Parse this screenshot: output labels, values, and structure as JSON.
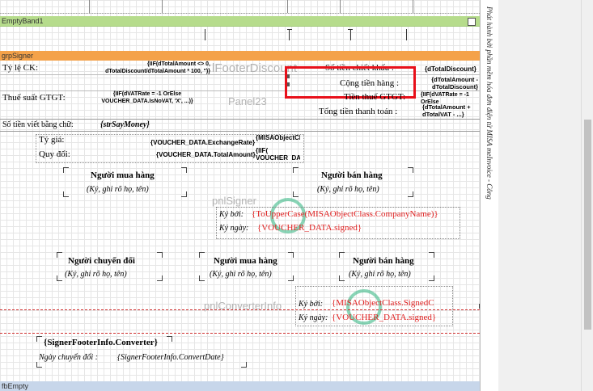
{
  "bands": {
    "empty_band": "EmptyBand1",
    "signer_band": "grpSigner",
    "empty_footer": "fbEmpty"
  },
  "footer_rows": {
    "discount_rate_label": "Tỷ lệ CK:",
    "discount_rate_expr": "{IIF(dTotalAmount <> 0, dTotalDiscount/dTotalAmount * 100, '')}",
    "discount_amount_label": "Số tiền chiết khấu :",
    "discount_amount_expr": "{dTotalDiscount}",
    "total_label": "Cộng tiền hàng :",
    "total_expr": "{dTotalAmount - dTotalDiscount}",
    "vat_rate_label": "Thuế suất GTGT:",
    "vat_rate_expr": "{IIF(dVATRate = -1 OrElse VOUCHER_DATA.IsNoVAT, 'X', ...)}",
    "vat_amount_label": "Tiền thuế GTGT:",
    "vat_amount_expr": "{IIF(dVATRate = -1 OrElse VOUCHER_DATA ...}",
    "grand_total_label": "Tổng tiền thanh toán :",
    "grand_total_expr": "{dTotalAmount + dTotalVAT - ...}",
    "in_words_label": "Số tiền viết bằng chữ:",
    "in_words_expr": "{strSayMoney}",
    "exchange_rate_label": "Tỷ giá:",
    "exchange_rate_expr": "{VOUCHER_DATA.ExchangeRate}",
    "converted_label": "Quy đổi:",
    "converted_expr": "{VOUCHER_DATA.TotalAmount}",
    "class_expr": "{MISAObjectClass}",
    "if_expr": "{IIF( VOUCHER_DATA ...}"
  },
  "ghost_labels": {
    "footer_discount": "lFooterDiscount",
    "panel": "Panel23",
    "pnl_signer": "pnlSigner",
    "pnl_converter": "pnlConverterInfo"
  },
  "signers": {
    "buyer_title": "Người mua hàng",
    "sign_hint": "(Ký, ghi rõ họ, tên)",
    "seller_title": "Người bán hàng",
    "signed_by_label": "Ký bởi:",
    "signed_by_expr": "{ToUpperCase(MISAObjectClass.CompanyName)}",
    "signed_date_label": "Ký ngày:",
    "signed_date_expr": "{VOUCHER_DATA.signed}",
    "converter_title": "Người chuyển đổi",
    "signed_by_expr2": "{MISAObjectClass.SignedC",
    "signed_date_expr2": "{VOUCHER_DATA.signed}",
    "footer_converter_expr": "{SignerFooterInfo.Converter}",
    "convert_date_label": "Ngày chuyển đổi :",
    "convert_date_expr": "{SignerFooterInfo.ConvertDate}"
  },
  "side_text": "Phát hành bởi phần mềm hóa đơn điện tử MISA meInvoice - Công",
  "colors": {
    "highlight": "#e8101a",
    "red_expr": "#e02020",
    "band_green": "#b6dc8c",
    "band_orange": "#f4a24a",
    "stamp": "#2ab27b"
  }
}
